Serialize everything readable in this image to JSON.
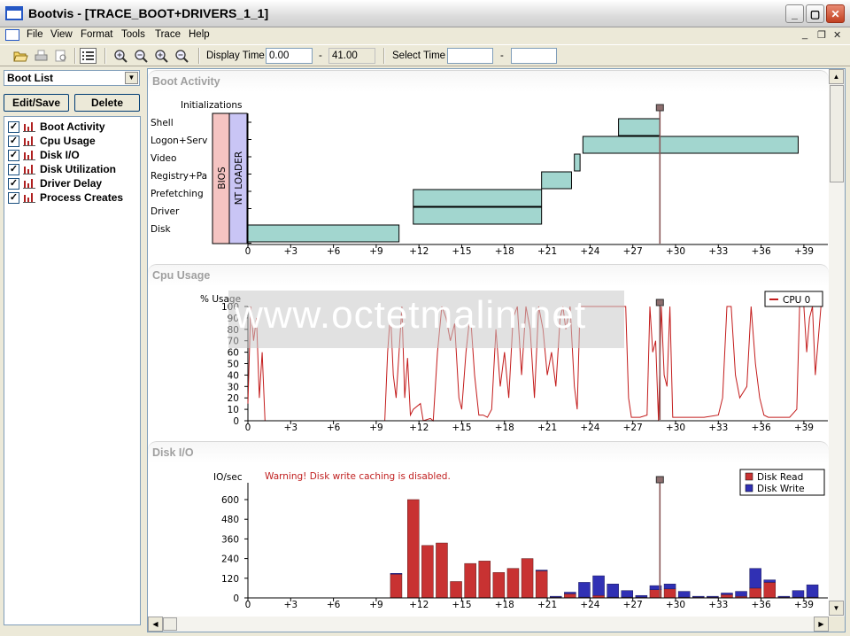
{
  "window": {
    "title": "Bootvis - [TRACE_BOOT+DRIVERS_1_1]"
  },
  "menu": [
    "File",
    "View",
    "Format",
    "Tools",
    "Trace",
    "Help"
  ],
  "toolbar": {
    "display_time_label": "Display Time",
    "display_start": "0.00",
    "dash1": "-",
    "display_end": "41.00",
    "select_time_label": "Select Time",
    "select_start": "",
    "dash2": "-",
    "select_end": ""
  },
  "sidebar": {
    "dropdown": "Boot List",
    "edit_save": "Edit/Save",
    "delete": "Delete",
    "graphs": [
      {
        "label": "Boot Activity",
        "checked": true
      },
      {
        "label": "Cpu Usage",
        "checked": true
      },
      {
        "label": "Disk I/O",
        "checked": true
      },
      {
        "label": "Disk Utilization",
        "checked": true
      },
      {
        "label": "Driver Delay",
        "checked": true
      },
      {
        "label": "Process Creates",
        "checked": true
      }
    ]
  },
  "panels": {
    "boot": "Boot Activity",
    "cpu": "Cpu Usage",
    "disk": "Disk I/O"
  },
  "watermark": "www.octetmalin.net",
  "colors": {
    "bar_fill": "#a2d6cf",
    "bios": "#f5c4c2",
    "loader": "#c9c5f5",
    "cpu_line": "#c31c1c",
    "disk_read": "#c83232",
    "disk_write": "#3030b4",
    "marker": "#8a5a5a"
  },
  "boot_chart": {
    "rows": [
      "Initializations",
      "Shell",
      "Logon+Serv",
      "Video",
      "Registry+Pa",
      "Prefetching",
      "Driver",
      "Disk"
    ],
    "bios_label": "BIOS",
    "loader_label": "NT LOADER",
    "bars": [
      {
        "row": "Disk",
        "start": 0,
        "end": 10.6
      },
      {
        "row": "Driver",
        "start": 11.6,
        "end": 20.6
      },
      {
        "row": "Prefetching",
        "start": 11.6,
        "end": 20.6
      },
      {
        "row": "Registry+Pa",
        "start": 20.6,
        "end": 22.7
      },
      {
        "row": "Video",
        "start": 22.9,
        "end": 23.3
      },
      {
        "row": "Logon+Serv",
        "start": 23.5,
        "end": 38.6
      },
      {
        "row": "Shell",
        "start": 26.0,
        "end": 28.9
      }
    ],
    "marker_time": 28.9,
    "x_ticks": [
      "0",
      "+3",
      "+6",
      "+9",
      "+12",
      "+15",
      "+18",
      "+21",
      "+24",
      "+27",
      "+30",
      "+33",
      "+36",
      "+39"
    ]
  },
  "cpu_chart": {
    "ylabel": "% Usage",
    "y_ticks": [
      "100",
      "90",
      "80",
      "70",
      "60",
      "50",
      "40",
      "30",
      "20",
      "10",
      "0"
    ],
    "legend": "CPU 0",
    "x_ticks": [
      "0",
      "+3",
      "+6",
      "+9",
      "+12",
      "+15",
      "+18",
      "+21",
      "+24",
      "+27",
      "+30",
      "+33",
      "+36",
      "+39"
    ],
    "points": [
      [
        0,
        15
      ],
      [
        0.2,
        100
      ],
      [
        0.4,
        70
      ],
      [
        0.6,
        90
      ],
      [
        0.8,
        20
      ],
      [
        1,
        60
      ],
      [
        1.2,
        0
      ],
      [
        1.5,
        0
      ],
      [
        3,
        0
      ],
      [
        6,
        0
      ],
      [
        9,
        0
      ],
      [
        9.6,
        0
      ],
      [
        9.8,
        60
      ],
      [
        10,
        95
      ],
      [
        10.2,
        40
      ],
      [
        10.4,
        20
      ],
      [
        10.6,
        60
      ],
      [
        10.8,
        100
      ],
      [
        11,
        20
      ],
      [
        11.2,
        55
      ],
      [
        11.4,
        5
      ],
      [
        11.6,
        10
      ],
      [
        12.1,
        15
      ],
      [
        12.3,
        0
      ],
      [
        12.8,
        2
      ],
      [
        13,
        0
      ],
      [
        13.3,
        60
      ],
      [
        13.6,
        100
      ],
      [
        13.9,
        90
      ],
      [
        14.2,
        70
      ],
      [
        14.5,
        85
      ],
      [
        14.8,
        20
      ],
      [
        15,
        10
      ],
      [
        15.3,
        60
      ],
      [
        15.6,
        95
      ],
      [
        15.9,
        40
      ],
      [
        16.2,
        5
      ],
      [
        16.5,
        5
      ],
      [
        16.8,
        3
      ],
      [
        17.1,
        10
      ],
      [
        17.4,
        80
      ],
      [
        17.7,
        30
      ],
      [
        18,
        60
      ],
      [
        18.3,
        20
      ],
      [
        18.6,
        90
      ],
      [
        18.9,
        100
      ],
      [
        19.2,
        40
      ],
      [
        19.5,
        100
      ],
      [
        19.8,
        80
      ],
      [
        20.1,
        20
      ],
      [
        20.4,
        100
      ],
      [
        20.7,
        80
      ],
      [
        21,
        40
      ],
      [
        21.3,
        60
      ],
      [
        21.6,
        30
      ],
      [
        21.9,
        90
      ],
      [
        22.1,
        100
      ],
      [
        22.3,
        80
      ],
      [
        22.6,
        100
      ],
      [
        22.9,
        30
      ],
      [
        23.1,
        10
      ],
      [
        23.3,
        100
      ],
      [
        24,
        100
      ],
      [
        25,
        100
      ],
      [
        26,
        100
      ],
      [
        26.5,
        100
      ],
      [
        26.7,
        20
      ],
      [
        26.9,
        3
      ],
      [
        27.5,
        3
      ],
      [
        28,
        5
      ],
      [
        28.2,
        100
      ],
      [
        28.4,
        60
      ],
      [
        28.6,
        70
      ],
      [
        28.8,
        0
      ],
      [
        29,
        100
      ],
      [
        29.2,
        40
      ],
      [
        29.4,
        30
      ],
      [
        29.6,
        100
      ],
      [
        29.8,
        3
      ],
      [
        30.5,
        3
      ],
      [
        32,
        3
      ],
      [
        33,
        5
      ],
      [
        33.3,
        20
      ],
      [
        33.6,
        100
      ],
      [
        33.9,
        100
      ],
      [
        34.2,
        40
      ],
      [
        34.5,
        20
      ],
      [
        35,
        30
      ],
      [
        35.3,
        100
      ],
      [
        35.6,
        50
      ],
      [
        35.9,
        20
      ],
      [
        36.2,
        5
      ],
      [
        36.5,
        3
      ],
      [
        38,
        3
      ],
      [
        38.5,
        10
      ],
      [
        38.7,
        100
      ],
      [
        39,
        100
      ],
      [
        39.2,
        60
      ],
      [
        39.4,
        90
      ],
      [
        39.6,
        100
      ],
      [
        39.8,
        40
      ],
      [
        40.2,
        100
      ]
    ],
    "marker_time": 28.9
  },
  "disk_chart": {
    "ylabel": "IO/sec",
    "warning": "Warning!  Disk write caching is disabled.",
    "y_ticks": [
      "600",
      "480",
      "360",
      "240",
      "120",
      "0"
    ],
    "legend": [
      "Disk Read",
      "Disk Write"
    ],
    "x_ticks": [
      "0",
      "+3",
      "+6",
      "+9",
      "+12",
      "+15",
      "+18",
      "+21",
      "+24",
      "+27",
      "+30",
      "+33",
      "+36",
      "+39"
    ],
    "bars": [
      {
        "t": 10.4,
        "read": 145,
        "write": 5
      },
      {
        "t": 11.6,
        "read": 600,
        "write": 0
      },
      {
        "t": 12.6,
        "read": 320,
        "write": 0
      },
      {
        "t": 13.6,
        "read": 335,
        "write": 0
      },
      {
        "t": 14.6,
        "read": 100,
        "write": 0
      },
      {
        "t": 15.6,
        "read": 210,
        "write": 0
      },
      {
        "t": 16.6,
        "read": 225,
        "write": 0
      },
      {
        "t": 17.6,
        "read": 155,
        "write": 0
      },
      {
        "t": 18.6,
        "read": 180,
        "write": 0
      },
      {
        "t": 19.6,
        "read": 240,
        "write": 0
      },
      {
        "t": 20.6,
        "read": 165,
        "write": 5
      },
      {
        "t": 21.6,
        "read": 5,
        "write": 5
      },
      {
        "t": 22.6,
        "read": 25,
        "write": 10
      },
      {
        "t": 23.6,
        "read": 5,
        "write": 90
      },
      {
        "t": 24.6,
        "read": 15,
        "write": 120
      },
      {
        "t": 25.6,
        "read": 5,
        "write": 80
      },
      {
        "t": 26.6,
        "read": 5,
        "write": 40
      },
      {
        "t": 27.6,
        "read": 5,
        "write": 10
      },
      {
        "t": 28.6,
        "read": 50,
        "write": 25
      },
      {
        "t": 29.6,
        "read": 55,
        "write": 30
      },
      {
        "t": 30.6,
        "read": 5,
        "write": 35
      },
      {
        "t": 31.6,
        "read": 5,
        "write": 5
      },
      {
        "t": 32.6,
        "read": 5,
        "write": 5
      },
      {
        "t": 33.6,
        "read": 20,
        "write": 10
      },
      {
        "t": 34.6,
        "read": 10,
        "write": 30
      },
      {
        "t": 35.6,
        "read": 60,
        "write": 120
      },
      {
        "t": 36.6,
        "read": 95,
        "write": 15
      },
      {
        "t": 37.6,
        "read": 5,
        "write": 5
      },
      {
        "t": 38.6,
        "read": 5,
        "write": 40
      },
      {
        "t": 39.6,
        "read": 5,
        "write": 75
      }
    ],
    "marker_time": 28.9
  }
}
